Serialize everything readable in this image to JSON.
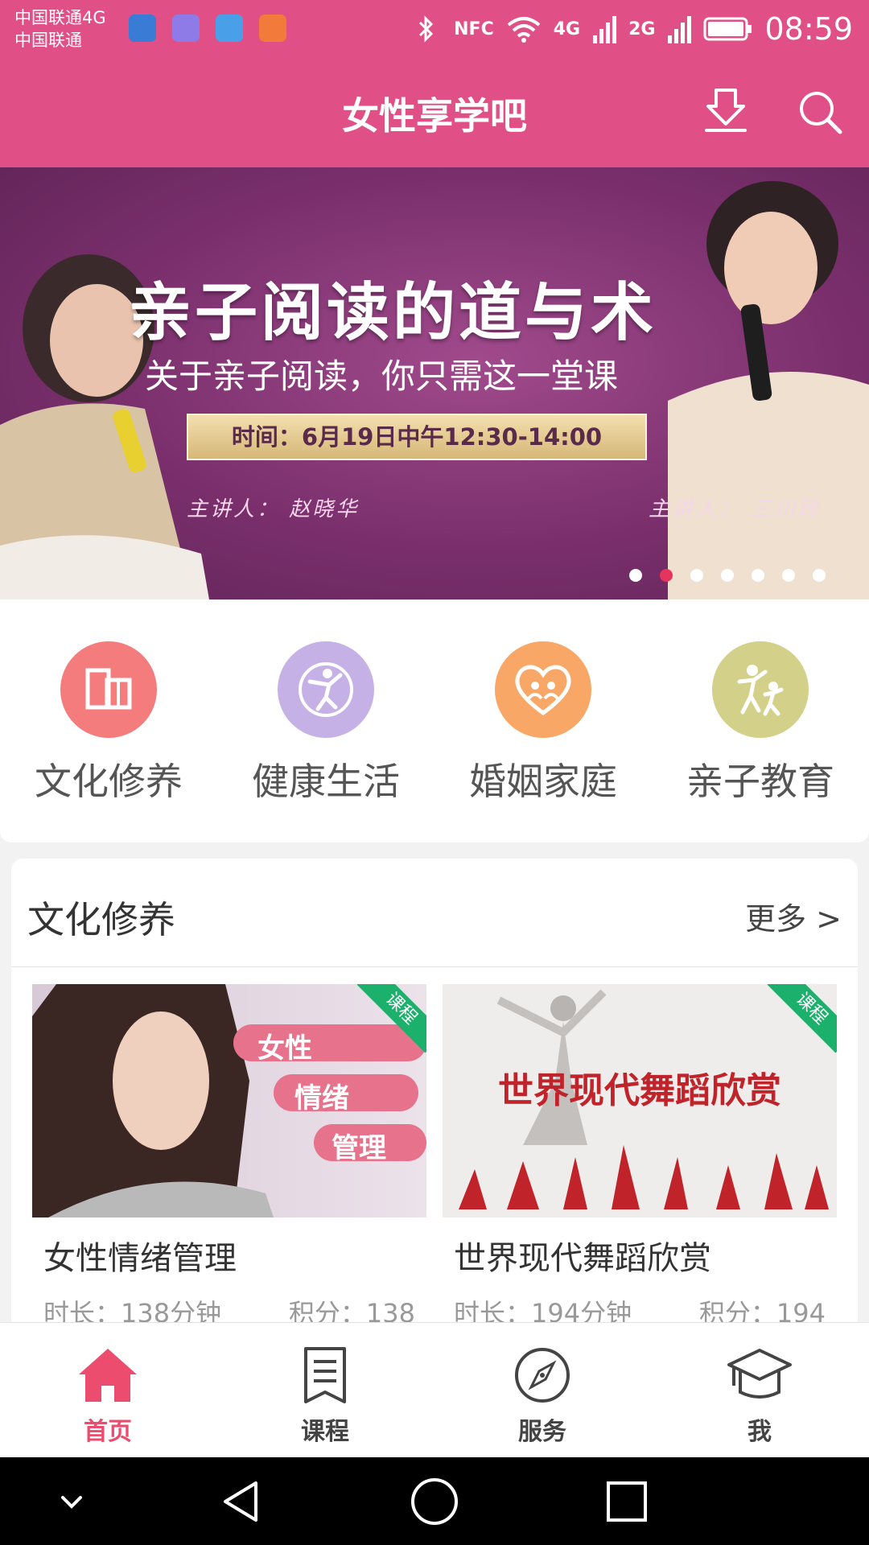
{
  "status_bar": {
    "carrier_line1": "中国联通4G",
    "carrier_line2": "中国联通",
    "tag_nfc": "NFC",
    "tag_4g": "4G",
    "tag_2g": "2G",
    "time": "08:59"
  },
  "header": {
    "title": "女性享学吧",
    "icons": [
      "download-icon",
      "search-icon"
    ],
    "brand_color": "#e04f86"
  },
  "banner": {
    "title": "亲子阅读的道与术",
    "subtitle": "关于亲子阅读，你只需这一堂课",
    "time": "时间：6月19日中午12:30-14:00",
    "speaker_left": "主讲人： 赵晓华",
    "speaker_right": "主讲人： 三川玲",
    "slides": 7,
    "active_slide": 2
  },
  "categories": [
    {
      "label": "文化修养",
      "icon": "book-icon",
      "color": "#f47c7c"
    },
    {
      "label": "健康生活",
      "icon": "dancer-icon",
      "color": "#c6b1e6"
    },
    {
      "label": "婚姻家庭",
      "icon": "heart-family-icon",
      "color": "#f9a766"
    },
    {
      "label": "亲子教育",
      "icon": "parent-child-icon",
      "color": "#d3d08a"
    }
  ],
  "section": {
    "title": "文化修养",
    "more": "更多 >",
    "courses": [
      {
        "name": "女性情绪管理",
        "ribbon": "课程",
        "thumb_tags": [
          "女性",
          "情绪",
          "管理"
        ],
        "duration": "时长：138分钟",
        "points": "积分：138"
      },
      {
        "name": "世界现代舞蹈欣赏",
        "ribbon": "课程",
        "thumb_title": "世界现代舞蹈欣赏",
        "duration": "时长：194分钟",
        "points": "积分：194"
      }
    ]
  },
  "tabs": [
    {
      "label": "首页",
      "icon": "home-icon",
      "active": true
    },
    {
      "label": "课程",
      "icon": "document-icon",
      "active": false
    },
    {
      "label": "服务",
      "icon": "compass-icon",
      "active": false
    },
    {
      "label": "我",
      "icon": "graduation-cap-icon",
      "active": false
    }
  ],
  "accent_color": "#ec4d6f"
}
